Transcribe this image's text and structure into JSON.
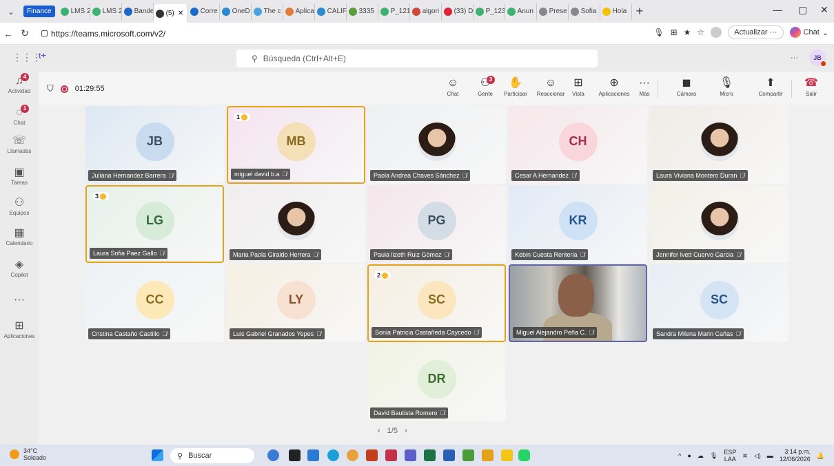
{
  "browser": {
    "tab_group": "Finance",
    "tabs": [
      {
        "label": "LMS 2",
        "color": "#3cb371"
      },
      {
        "label": "LMS 2",
        "color": "#3cb371"
      },
      {
        "label": "Bande",
        "color": "#1b6ac9"
      },
      {
        "label": "(5)",
        "color": "#333333",
        "active": true
      },
      {
        "label": "Corre",
        "color": "#1b6ac9"
      },
      {
        "label": "OneD",
        "color": "#2a8ad4"
      },
      {
        "label": "The c",
        "color": "#4aa3df"
      },
      {
        "label": "Aplica",
        "color": "#e07b39"
      },
      {
        "label": "CALIF",
        "color": "#2a8ad4"
      },
      {
        "label": "3335",
        "color": "#5a9e3a"
      },
      {
        "label": "P_121",
        "color": "#3cb371"
      },
      {
        "label": "algori",
        "color": "#d04a3a"
      },
      {
        "label": "(33) D",
        "color": "#e0223a"
      },
      {
        "label": "P_123",
        "color": "#3cb371"
      },
      {
        "label": "Anun",
        "color": "#3cb371"
      },
      {
        "label": "Prese",
        "color": "#888888"
      },
      {
        "label": "Sofia",
        "color": "#888888"
      },
      {
        "label": "Hola",
        "color": "#f2c200"
      }
    ],
    "url": "https://teams.microsoft.com/v2/",
    "update_label": "Actualizar",
    "chat_label": "Chat"
  },
  "teams": {
    "search_placeholder": "Búsqueda (Ctrl+Alt+E)",
    "user_initials": "JB",
    "rail": [
      {
        "label": "Actividad",
        "icon": "bell-icon",
        "badge": "4"
      },
      {
        "label": "Chat",
        "icon": "chat-icon",
        "badge": "1"
      },
      {
        "label": "Llamadas",
        "icon": "phone-icon"
      },
      {
        "label": "Tareas",
        "icon": "tasks-icon"
      },
      {
        "label": "Equipos",
        "icon": "teams-icon"
      },
      {
        "label": "Calendario",
        "icon": "calendar-icon"
      },
      {
        "label": "Copilot",
        "icon": "copilot-icon"
      },
      {
        "label": "...",
        "icon": "more-icon"
      },
      {
        "label": "Aplicaciones",
        "icon": "apps-icon"
      }
    ]
  },
  "meeting": {
    "timer": "01:29:55",
    "toolbar": [
      {
        "label": "Chat",
        "icon": "chat-icon"
      },
      {
        "label": "Gente",
        "icon": "people-icon",
        "badge": "3"
      },
      {
        "label": "Participar",
        "icon": "raise-hand-icon"
      },
      {
        "label": "Reaccionar",
        "icon": "smiley-icon"
      },
      {
        "label": "Vista",
        "icon": "grid-view-icon"
      },
      {
        "label": "Aplicaciones",
        "icon": "add-app-icon"
      },
      {
        "label": "Más",
        "icon": "more-icon"
      },
      {
        "label": "Cámara",
        "icon": "camera-off-icon"
      },
      {
        "label": "Micro",
        "icon": "mic-off-icon"
      },
      {
        "label": "Compartir",
        "icon": "share-icon"
      },
      {
        "label": "Salir",
        "icon": "hangup-icon"
      }
    ],
    "participants": [
      {
        "initials": "JB",
        "name": "Juliana Hernandez Barrera",
        "avatar": "#c9dcef",
        "ini_color": "#3b4f63",
        "bg": "#dde8f3"
      },
      {
        "initials": "MB",
        "name": "miguel david b.a",
        "avatar": "#f3e0b6",
        "ini_color": "#8a6a1d",
        "bg": "#f4e4f0",
        "hand": "1",
        "highlight": true
      },
      {
        "initials": "",
        "name": "Paola Andrea Chaves Sánchez",
        "photo": true,
        "bg": "#eef0f2"
      },
      {
        "initials": "CH",
        "name": "Cesar A Hernandez",
        "avatar": "#f8d6dc",
        "ini_color": "#a02e4a",
        "bg": "#f6e7eb"
      },
      {
        "initials": "",
        "name": "Laura Viviana Montero Duran",
        "photo": true,
        "bg": "#f0ece6"
      },
      {
        "initials": "LG",
        "name": "Laura Sofia Paez Gallo",
        "avatar": "#d6ecd8",
        "ini_color": "#2e6b38",
        "bg": "#e6f1ea",
        "hand": "3",
        "highlight": true
      },
      {
        "initials": "",
        "name": "Maria Paola Giraldo Herrera",
        "photo": true,
        "bg": "#f0eeee"
      },
      {
        "initials": "PG",
        "name": "Paula lizeth Ruiz Gómez",
        "avatar": "#d4dde6",
        "ini_color": "#3b4f63",
        "bg": "#f4e6ea"
      },
      {
        "initials": "KR",
        "name": "Kebin Cuesta Renteria",
        "avatar": "#cfe1f5",
        "ini_color": "#24558f",
        "bg": "#e2eaf6"
      },
      {
        "initials": "",
        "name": "Jennifer Ivett Cuervo Garcia",
        "photo": true,
        "bg": "#f2f0e6"
      },
      {
        "initials": "CC",
        "name": "Cristina Castaño Castillo",
        "avatar": "#fde8b8",
        "ini_color": "#8a6a1d",
        "bg": "#eef2f4"
      },
      {
        "initials": "LY",
        "name": "Luis Gabriel Granados Yepes",
        "avatar": "#f7e1d0",
        "ini_color": "#8a4e2a",
        "bg": "#f6efe2"
      },
      {
        "initials": "SC",
        "name": "Sonia Patricia Castañeda Caycedo",
        "avatar": "#fbe6c0",
        "ini_color": "#8a6a1d",
        "bg": "#f6efe2",
        "hand": "2",
        "highlight": true
      },
      {
        "initials": "",
        "name": "Miguel Alejandro Peña C.",
        "video": true,
        "bg": "#8c8c8c"
      },
      {
        "initials": "SC",
        "name": "Sandra Milena Marin Cañas",
        "avatar": "#d4e4f4",
        "ini_color": "#24558f",
        "bg": "#e6eef6"
      },
      {
        "initials": "DR",
        "name": "David Bautista Romero",
        "avatar": "#e2efd8",
        "ini_color": "#3e6b2e",
        "bg": "#f1f3e4"
      }
    ],
    "pager": "1/5"
  },
  "taskbar": {
    "temp": "34°C",
    "weather": "Soleado",
    "search": "Buscar",
    "lang": "ESP",
    "lang2": "LAA",
    "time": "3:14 p.m.",
    "date": "12/06/2026"
  }
}
